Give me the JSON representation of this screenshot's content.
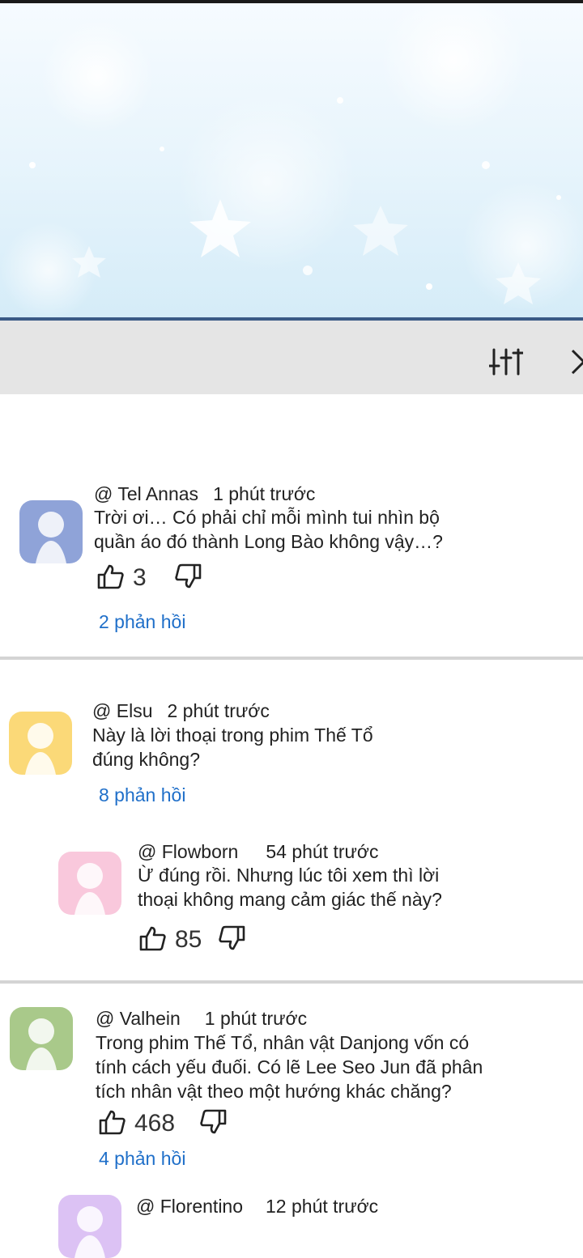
{
  "comments": [
    {
      "handle": "@ Tel Annas",
      "time": "1 phút trước",
      "lines": [
        "Trời ơi… Có phải chỉ mỗi mình tui nhìn bộ",
        "quần áo đó thành Long Bào không vậy…?"
      ],
      "likes": "3",
      "replies": "2 phản hồi",
      "avatar_color": "#8fa3d8"
    },
    {
      "handle": "@ Elsu",
      "time": "2 phút trước",
      "lines": [
        "Này là lời thoại trong phim Thế Tổ",
        "đúng không?"
      ],
      "replies": "8 phản hồi",
      "avatar_color": "#fbd978"
    },
    {
      "handle": "@ Flowborn",
      "time": "54 phút trước",
      "lines": [
        "Ừ đúng rồi. Nhưng lúc tôi xem thì lời",
        "thoại không mang cảm giác thế này?"
      ],
      "likes": "85",
      "avatar_color": "#f9c8dc"
    },
    {
      "handle": "@ Valhein",
      "time": "1 phút trước",
      "lines": [
        "Trong phim Thế Tổ, nhân vật Danjong vốn có",
        "tính cách yếu đuối. Có lẽ Lee Seo Jun đã phân",
        "tích nhân vật theo một hướng khác chăng?"
      ],
      "likes": "468",
      "replies": "4 phản hồi",
      "avatar_color": "#a9c98a"
    },
    {
      "handle": "@ Florentino",
      "time": "12 phút trước",
      "avatar_color": "#dcc2f4"
    }
  ],
  "toolbar": {
    "filter_icon": "sliders-icon",
    "next_icon": "chevron-right-icon"
  },
  "colors": {
    "link": "#1f6fc9",
    "toolbar_bg": "#e5e5e5",
    "divider": "#d4d4d4",
    "hero_border": "#3b5a86"
  }
}
